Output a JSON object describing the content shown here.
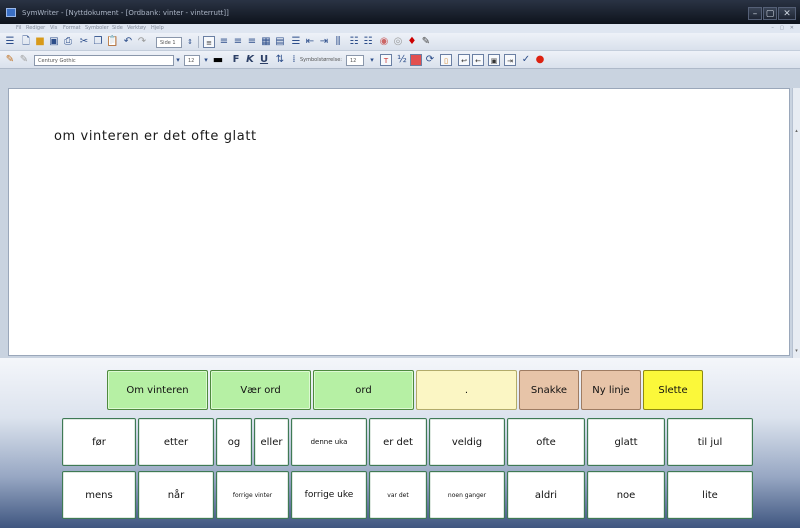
{
  "window": {
    "title": "SymWriter - [Nyttdokument - [Ordbank: vinter - vinterrutt]]",
    "controls": {
      "minimize": "–",
      "maximize": "▢",
      "close": "✕"
    }
  },
  "menubar": {
    "items": [
      "Fil",
      "Rediger",
      "Vis",
      "Format",
      "Symboler",
      "Side",
      "Verktøy",
      "Hjelp"
    ],
    "mdi_controls": "– ▢ ✕"
  },
  "toolbar": {
    "page_label": "Side 1",
    "font_name": "Century Gothic",
    "font_size": "12",
    "symbol_size_label": "Symbolstørrelse:",
    "symbol_size": "12",
    "bold": "F",
    "italic": "K",
    "underline": "U"
  },
  "document": {
    "text": "om vinteren er det ofte glatt"
  },
  "grid": {
    "phrase_row": [
      {
        "label": "Om vinteren",
        "style": "green"
      },
      {
        "label": "Vær ord",
        "style": "green"
      },
      {
        "label": "ord",
        "style": "green"
      },
      {
        "label": ".",
        "style": "cream"
      },
      {
        "label": "Snakke",
        "style": "tan"
      },
      {
        "label": "Ny linje",
        "style": "tan"
      },
      {
        "label": "Slette",
        "style": "yellow"
      }
    ],
    "word_row_1": [
      "før",
      "etter",
      "og",
      "eller",
      "denne uka",
      "er det",
      "veldig",
      "ofte",
      "glatt",
      "til jul"
    ],
    "word_row_2": [
      "mens",
      "når",
      "forrige vinter",
      "forrige uke",
      "var det",
      "noen ganger",
      "aldri",
      "noe",
      "lite"
    ]
  },
  "colors": {
    "green": "#b6f0a4",
    "cream": "#fbf6c4",
    "tan": "#e7c4a8",
    "yellow": "#fbf83a",
    "titlebar": "#1c2433"
  }
}
